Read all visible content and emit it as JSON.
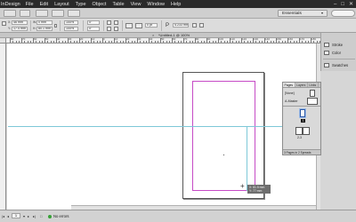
{
  "menubar": {
    "app_name": "InDesign",
    "items": [
      "File",
      "Edit",
      "Layout",
      "Type",
      "Object",
      "Table",
      "View",
      "Window",
      "Help"
    ],
    "window_controls": [
      "–",
      "□",
      "✕"
    ]
  },
  "appbar": {
    "workspace": "Essentials",
    "workspace_caret": "▾"
  },
  "control_panel": {
    "x_label": "X:",
    "x_value": "46 mm",
    "y_label": "Y:",
    "y_value": "17.4 mm",
    "w_label": "W:",
    "w_value": "0 mm",
    "h_label": "H:",
    "h_value": "80.1 mm",
    "stroke_value": "0 pt",
    "pct_1": "100%",
    "pct_2": "100%",
    "angle_1": "0°",
    "angle_2": "0°",
    "mm_value": "4.233 mm",
    "p_glyph": "P"
  },
  "document_tab": {
    "title": "*Untitled-1 @ 100%",
    "close": "×"
  },
  "hruler": {
    "labels": [
      "80",
      "70",
      "60",
      "50",
      "40",
      "30",
      "20",
      "10",
      "0",
      "10",
      "20",
      "30",
      "40",
      "50",
      "60",
      "70",
      "80",
      "90",
      "100",
      "110",
      "120",
      "130",
      "140",
      "150",
      "160",
      "170",
      "180"
    ]
  },
  "canvas": {
    "tooltip_line1": "X: 81.5 mm",
    "tooltip_line2": "Y: 77 mm"
  },
  "panel_strip": {
    "items": [
      {
        "label": "Stroke",
        "icon": "stroke-icon"
      },
      {
        "label": "Color",
        "icon": "color-icon"
      },
      {
        "label": "Swatches",
        "icon": "swatches-icon"
      }
    ]
  },
  "pages_panel": {
    "tabs": [
      "Pages",
      "Layers",
      "Links"
    ],
    "none_label": "[None]",
    "master_label": "A-Master",
    "page1_number": "1",
    "spread_label": "2-3",
    "footer": "3 Pages in 2 Spreads"
  },
  "statusbar": {
    "page": "1",
    "errors": "No errors",
    "nav_first": "|◂",
    "nav_prev": "◂",
    "nav_next": "▸",
    "nav_last": "▸|"
  }
}
